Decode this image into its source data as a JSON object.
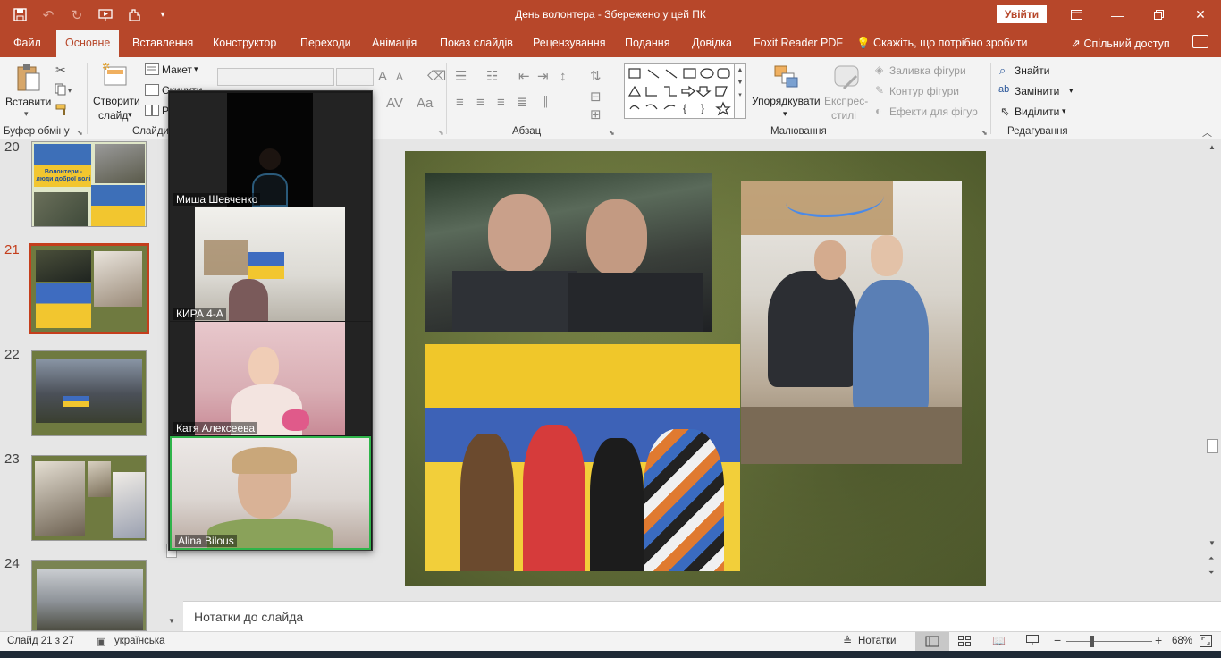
{
  "window": {
    "title": "День волонтера  -  Збережено у цей ПК",
    "signin_label": "Увійти"
  },
  "tabs": [
    "Файл",
    "Основне",
    "Вставлення",
    "Конструктор",
    "Переходи",
    "Анімація",
    "Показ слайдів",
    "Рецензування",
    "Подання",
    "Довідка",
    "Foxit Reader PDF"
  ],
  "tell_me": "Скажіть, що потрібно зробити",
  "share_label": "Спільний доступ",
  "ribbon": {
    "clipboard": {
      "paste": "Вставити",
      "label": "Буфер обміну"
    },
    "slides": {
      "new_slide_1": "Створити",
      "new_slide_2": "слайд",
      "layout": "Макет",
      "reset": "Скинути",
      "section": "Р",
      "label": "Слайди"
    },
    "paragraph": {
      "label": "Абзац"
    },
    "drawing": {
      "arrange": "Упорядкувати",
      "quick_styles_1": "Експрес-",
      "quick_styles_2": "стилі",
      "shape_fill": "Заливка фігури",
      "shape_outline": "Контур фігури",
      "shape_effects": "Ефекти для фігур",
      "label": "Малювання"
    },
    "editing": {
      "find": "Знайти",
      "replace": "Замінити",
      "select": "Виділити",
      "label": "Редагування"
    }
  },
  "thumbnails": [
    {
      "num": "20",
      "caption_1": "Волонтери -",
      "caption_2": "люди доброї волі"
    },
    {
      "num": "21"
    },
    {
      "num": "22"
    },
    {
      "num": "23"
    },
    {
      "num": "24"
    }
  ],
  "video_call": {
    "participants": [
      "Миша Шевченко",
      "КИРА 4-А",
      "Катя Алексеева",
      "Alina Bilous"
    ]
  },
  "notes_placeholder": "Нотатки до слайда",
  "status": {
    "slide_info": "Слайд 21 з 27",
    "language": "українська",
    "notes": "Нотатки",
    "zoom": "68%"
  },
  "colors": {
    "accent": "#b7472a",
    "active_thumb": "#c43e1c",
    "active_speaker": "#2fb44a"
  }
}
